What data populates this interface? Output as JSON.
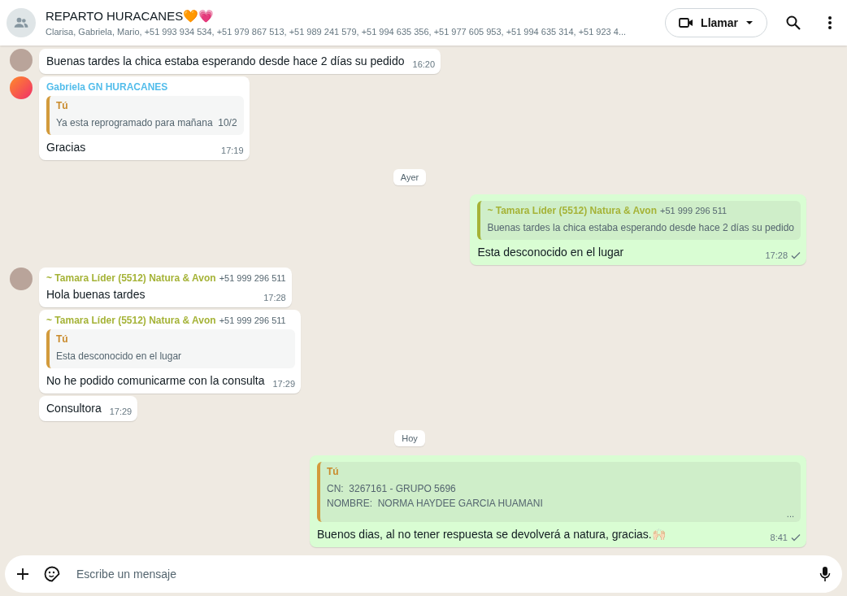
{
  "header": {
    "title": "REPARTO HURACANES🧡💗",
    "subtitle": "Clarisa, Gabriela, Mario, +51 993 934 534, +51 979 867 513, +51 989 241 579, +51 994 635 356, +51 977 605 953, +51 994 635 314, +51 923 4...",
    "call_button": "Llamar"
  },
  "messages": [
    {
      "kind": "incoming",
      "avatar": {
        "kind": "photo"
      },
      "text": "Buenas tardes la chica estaba esperando desde hace 2 días su pedido",
      "time": "16:20"
    },
    {
      "kind": "incoming",
      "avatar": {
        "kind": "logo"
      },
      "sender": {
        "name": "Gabriela GN HURACANES",
        "color": "#53bdeb"
      },
      "quote": {
        "author": "Tú",
        "lines": [
          "Ya esta reprogramado para mañana  10/2"
        ]
      },
      "text": "Gracias",
      "time": "17:19"
    },
    {
      "kind": "date",
      "text": "Ayer"
    },
    {
      "kind": "outgoing",
      "quote": {
        "author": "~ Tamara Líder (5512) Natura & Avon",
        "phone": "+51 999 296 511",
        "lines": [
          "Buenas tardes la chica estaba esperando desde hace 2 días su pedido"
        ]
      },
      "text": "Esta desconocido en el lugar",
      "time": "17:28",
      "sent": true
    },
    {
      "kind": "incoming",
      "avatar": {
        "kind": "photo"
      },
      "sender": {
        "name": "~ Tamara Líder (5512) Natura & Avon",
        "color": "#a5b337",
        "phone": "+51 999 296 511"
      },
      "text": "Hola buenas tardes",
      "time": "17:28"
    },
    {
      "kind": "incoming",
      "sender": {
        "name": "~ Tamara Líder (5512) Natura & Avon",
        "color": "#a5b337",
        "phone": "+51 999 296 511"
      },
      "quote": {
        "author": "Tú",
        "lines": [
          "Esta desconocido en el lugar"
        ]
      },
      "text": "No he podido comunicarme con la consulta",
      "time": "17:29"
    },
    {
      "kind": "incoming",
      "text": "Consultora",
      "time": "17:29"
    },
    {
      "kind": "date",
      "text": "Hoy"
    },
    {
      "kind": "outgoing",
      "quote": {
        "author": "Tú",
        "lines": [
          "CN:  3267161 - GRUPO 5696",
          "NOMBRE:  NORMA HAYDEE GARCIA HUAMANI"
        ],
        "more": "..."
      },
      "text": "Buenos dias, al no tener respuesta se devolverá a natura, gracias.🙌🏻",
      "time": "8:41",
      "sent": true
    }
  ],
  "composer": {
    "placeholder": "Escribe un mensaje"
  }
}
